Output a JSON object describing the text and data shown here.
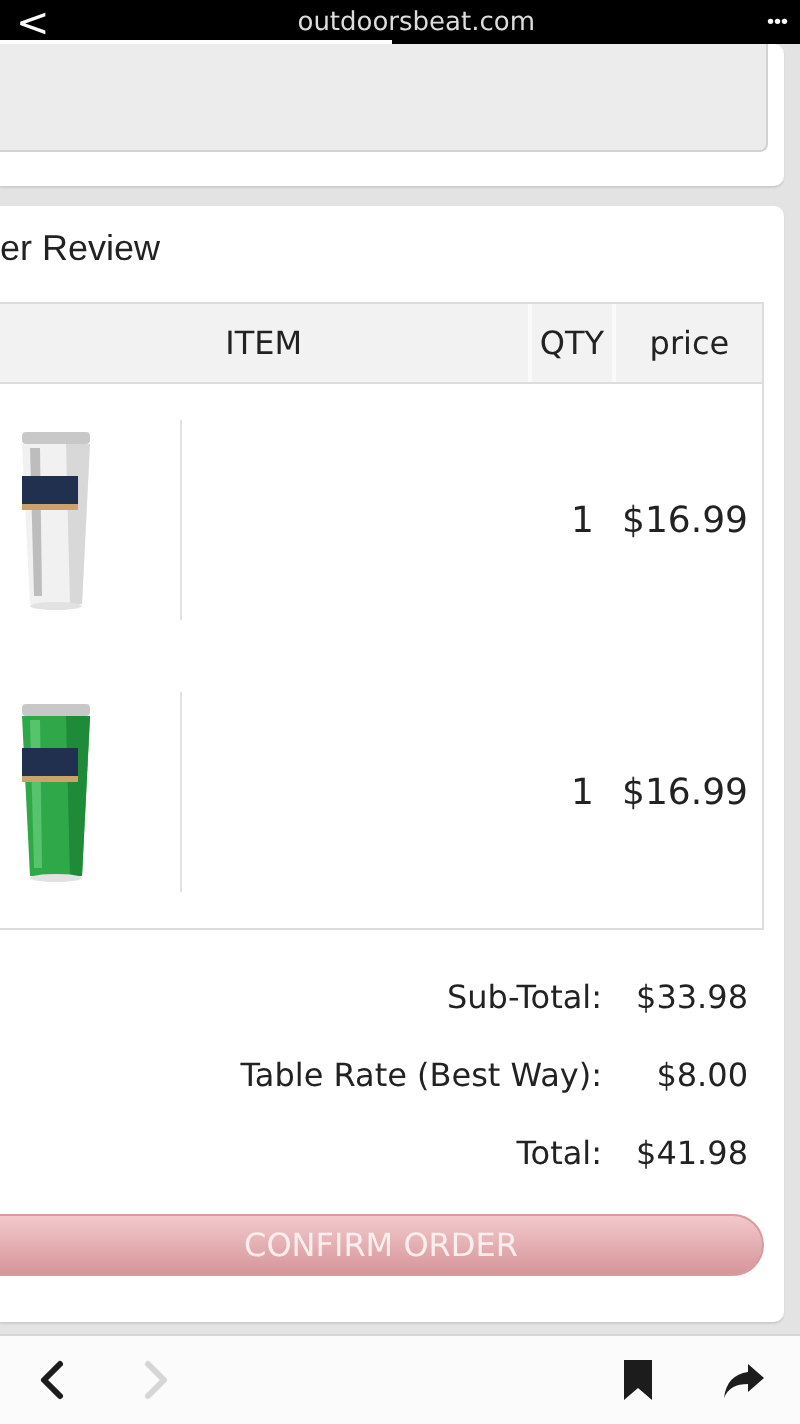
{
  "browser": {
    "back": "<",
    "url": "outdoorsbeat.com",
    "menu": "•••",
    "progress": {
      "level": 0.49
    }
  },
  "section": {
    "title": "er Review"
  },
  "table": {
    "columns": [
      "ITEM",
      "QTY",
      "price"
    ],
    "rows": [
      {
        "qty": "1",
        "price": "$16.99"
      },
      {
        "qty": "1",
        "price": "$16.99"
      }
    ]
  },
  "totals": [
    {
      "label": "Sub-Total:",
      "value": "$33.98"
    },
    {
      "label": "Table Rate (Best Way):",
      "value": "$8.00"
    },
    {
      "label": "Total:",
      "value": "$41.98"
    }
  ],
  "confirm_button": {
    "label": "CONFIRM ORDER"
  },
  "toolbar": [
    {
      "kind": "back",
      "disabled": false
    },
    {
      "kind": "forward",
      "disabled": true
    },
    {
      "kind": "bookmark",
      "disabled": false
    },
    {
      "kind": "share",
      "disabled": false
    }
  ]
}
